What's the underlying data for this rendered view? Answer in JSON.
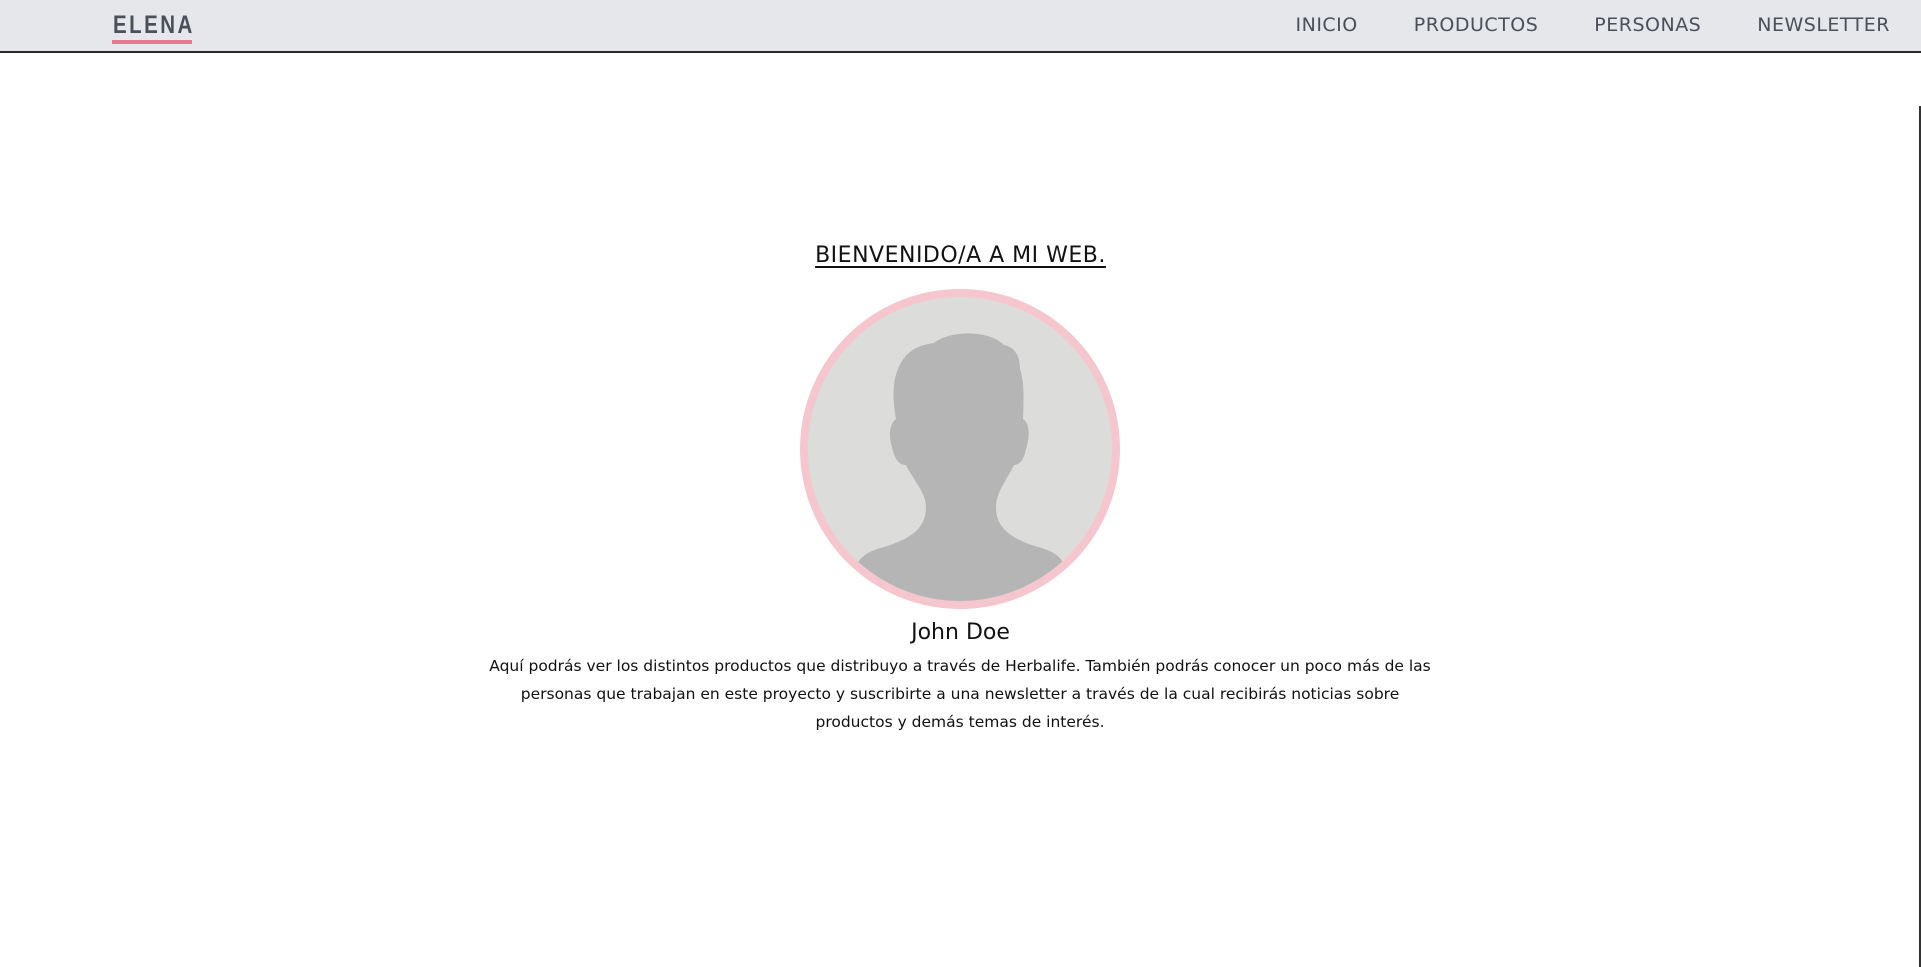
{
  "header": {
    "logo": "ELENA",
    "nav": [
      {
        "label": "INICIO"
      },
      {
        "label": "PRODUCTOS"
      },
      {
        "label": "PERSONAS"
      },
      {
        "label": "NEWSLETTER"
      }
    ]
  },
  "main": {
    "welcome": "BIENVENIDO/A A MI WEB.",
    "avatar_icon": "person-silhouette-icon",
    "name": "John Doe",
    "description": "Aquí podrás ver los distintos productos que distribuyo a través de Herbalife. También podrás conocer un poco más de las personas que trabajan en este proyecto y suscribirte a una newsletter a través de la cual recibirás noticias sobre productos y demás temas de interés."
  },
  "colors": {
    "header_bg": "#e5e7ea",
    "accent_pink": "#e8798f",
    "avatar_border": "#f6c6cf",
    "silhouette": "#b5b5b5"
  }
}
